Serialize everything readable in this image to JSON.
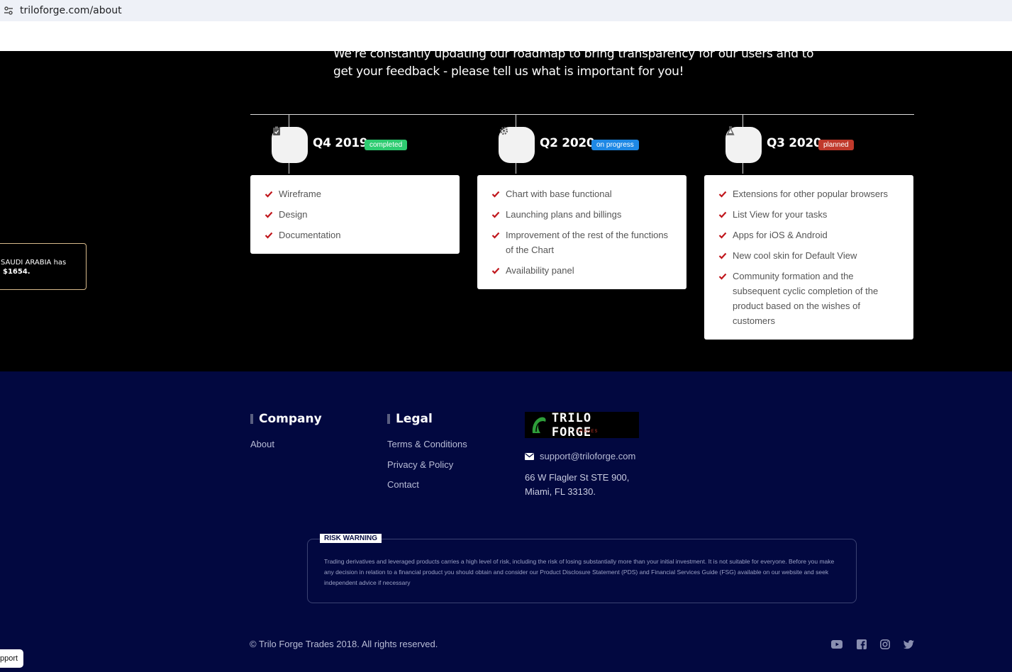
{
  "browser": {
    "url": "triloforge.com/about"
  },
  "intro_text": "We're constantly updating our roadmap to bring transparency for our users and to get your feedback - please tell us what is important for you!",
  "roadmap": [
    {
      "quarter": "Q4 2019",
      "badge": "completed",
      "badge_color": "#2ecc71",
      "icon": "clipboard-check-icon",
      "items": [
        "Wireframe",
        "Design",
        "Documentation"
      ]
    },
    {
      "quarter": "Q2 2020",
      "badge": "on progress",
      "badge_color": "#1e88e5",
      "icon": "gear-icon",
      "items": [
        "Chart with base functional",
        "Launching plans and billings",
        "Improvement of the rest of the functions of the Chart",
        "Availability panel"
      ]
    },
    {
      "quarter": "Q3 2020",
      "badge": "planned",
      "badge_color": "#c0392b",
      "icon": "flask-icon",
      "items": [
        "Extensions for other popular browsers",
        "List View for your tasks",
        "Apps for iOS & Android",
        "New cool skin for Default View",
        "Community formation and the subsequent cyclic completion of the product based on the wishes of customers"
      ]
    }
  ],
  "popup": {
    "line1": "SAUDI ARABIA has",
    "line2": "$1654."
  },
  "footer": {
    "company_heading": "Company",
    "company_links": [
      "About"
    ],
    "legal_heading": "Legal",
    "legal_links": [
      "Terms & Conditions",
      "Privacy & Policy",
      "Contact"
    ],
    "logo_name": "TRILO FORGE",
    "logo_sub": "TRADES",
    "email": "support@triloforge.com",
    "address_line1": "66 W Flagler St STE 900,",
    "address_line2": "Miami, FL 33130.",
    "risk_label": "RISK WARNING",
    "risk_text": "Trading derivatives and leveraged products carries a high level of risk, including the risk of losing substantially more than your initial investment. It is not suitable for everyone. Before you make any decision in relation to a financial product you should obtain and consider our Product Disclosure Statement (PDS) and Financial Services Guide (FSG) available on our website and seek independent advice if necessary",
    "copyright": "© Trilo Forge Trades 2018. All rights reserved.",
    "social": [
      "youtube-icon",
      "facebook-icon",
      "instagram-icon",
      "twitter-icon"
    ]
  },
  "support_label": "pport",
  "colors": {
    "accent_check": "#c0161c",
    "footer_bg": "#020840"
  }
}
